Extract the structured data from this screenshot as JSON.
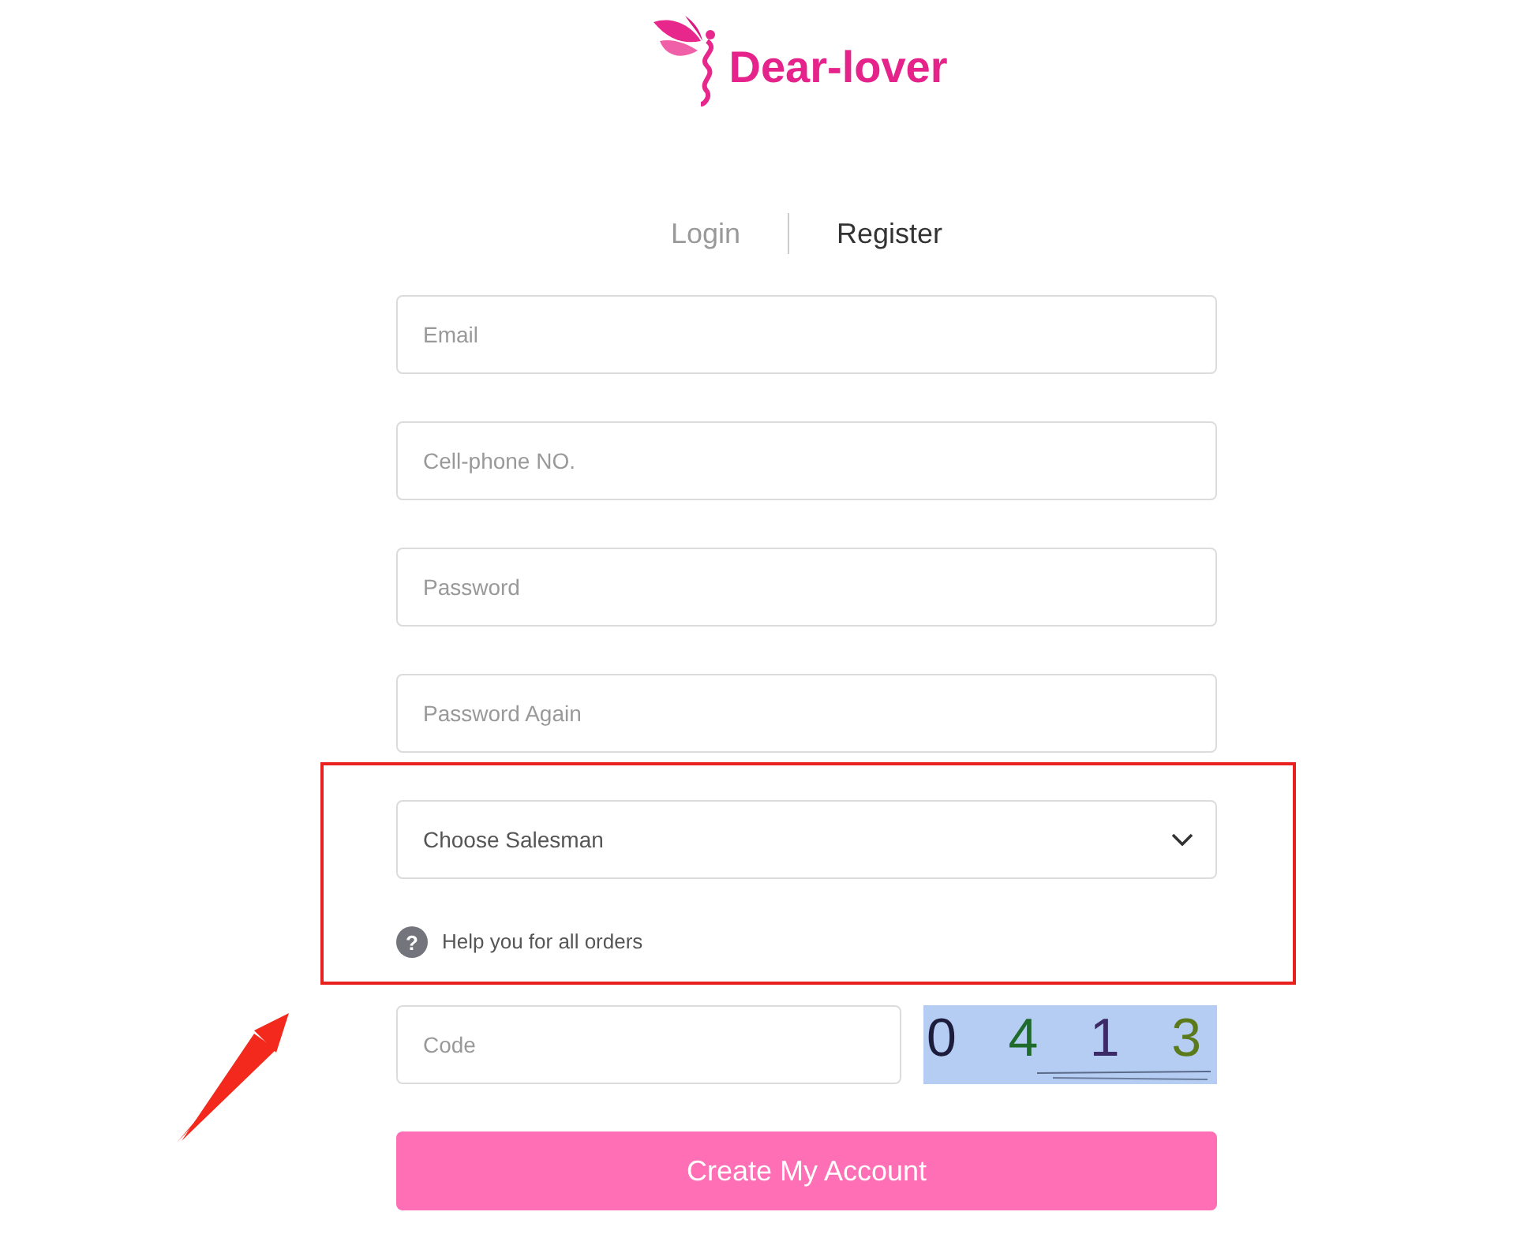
{
  "logo": {
    "text": "Dear-lover"
  },
  "tabs": [
    {
      "label": "Login",
      "selected": false
    },
    {
      "label": "Register",
      "selected": true
    }
  ],
  "fields": [
    {
      "placeholder": "Email"
    },
    {
      "placeholder": "Cell-phone NO."
    },
    {
      "placeholder": "Password"
    },
    {
      "placeholder": "Password Again"
    }
  ],
  "salesman_select": {
    "value": "Choose Salesman"
  },
  "help": {
    "icon": "?",
    "text": "Help you for all orders"
  },
  "code_field": {
    "placeholder": "Code"
  },
  "captcha": {
    "characters": [
      {
        "text": "0",
        "color": "#1c1c3c"
      },
      {
        "text": "4",
        "color": "#1f6b2c"
      },
      {
        "text": "1",
        "color": "#3b2a66"
      },
      {
        "text": "3",
        "color": "#5b7a1c"
      }
    ]
  },
  "submit_button": {
    "label": "Create My Account"
  }
}
